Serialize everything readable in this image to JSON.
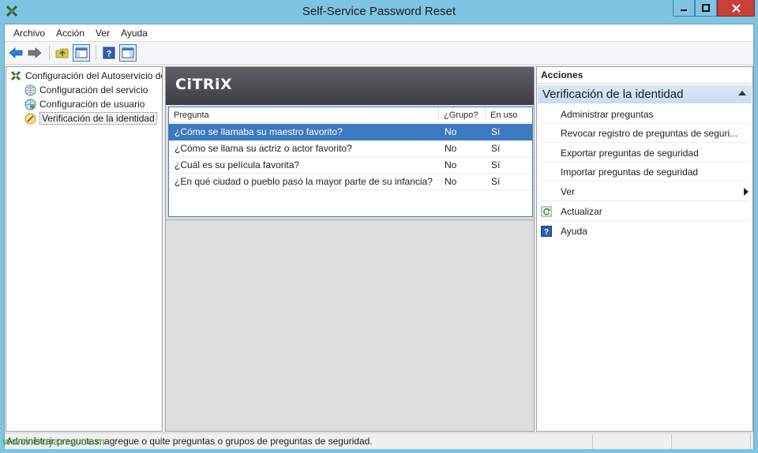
{
  "window": {
    "title": "Self-Service Password Reset"
  },
  "menu": [
    "Archivo",
    "Acción",
    "Ver",
    "Ayuda"
  ],
  "toolbar": {
    "buttons": [
      "back-arrow-icon",
      "forward-arrow-icon",
      "up-folder-icon",
      "show-hide-console-tree-icon",
      "help-icon",
      "show-hide-action-pane-icon"
    ]
  },
  "tree": {
    "root": "Configuración del Autoservicio de",
    "items": [
      "Configuración del servicio",
      "Configuración de usuario",
      "Verificación de la identidad"
    ],
    "selected_index": 2
  },
  "brand": {
    "logo_text": "CiTRiX"
  },
  "list": {
    "columns": [
      "Pregunta",
      "¿Grupo?",
      "En uso"
    ],
    "rows": [
      {
        "pregunta": "¿Cómo se llamaba su maestro favorito?",
        "grupo": "No",
        "en_uso": "Sí"
      },
      {
        "pregunta": "¿Cómo se llama su actriz o actor favorito?",
        "grupo": "No",
        "en_uso": "Sí"
      },
      {
        "pregunta": "¿Cuál es su película favorita?",
        "grupo": "No",
        "en_uso": "Sí"
      },
      {
        "pregunta": "¿En qué ciudad o pueblo pasó la mayor parte de su infancia?",
        "grupo": "No",
        "en_uso": "Sí"
      }
    ],
    "selected_index": 0
  },
  "actions": {
    "title": "Acciones",
    "group": "Verificación de la identidad",
    "items": [
      {
        "label": "Administrar preguntas",
        "icon": ""
      },
      {
        "label": "Revocar registro de preguntas de seguri...",
        "icon": ""
      },
      {
        "label": "Exportar preguntas de seguridad",
        "icon": ""
      },
      {
        "label": "Importar preguntas de seguridad",
        "icon": ""
      },
      {
        "label": "Ver",
        "icon": "",
        "submenu": true
      },
      {
        "label": "Actualizar",
        "icon": "refresh-icon"
      },
      {
        "label": "Ayuda",
        "icon": "help-icon"
      }
    ]
  },
  "status": {
    "text": "Administrar preguntas: agregue o quite preguntas o grupos de preguntas de seguridad."
  },
  "watermark": "www.bujarra.com",
  "colors": {
    "titlebar": "#7fc4e3",
    "selection": "#3b79c0",
    "close_button": "#c7403a",
    "banner": "#4a4b50"
  }
}
